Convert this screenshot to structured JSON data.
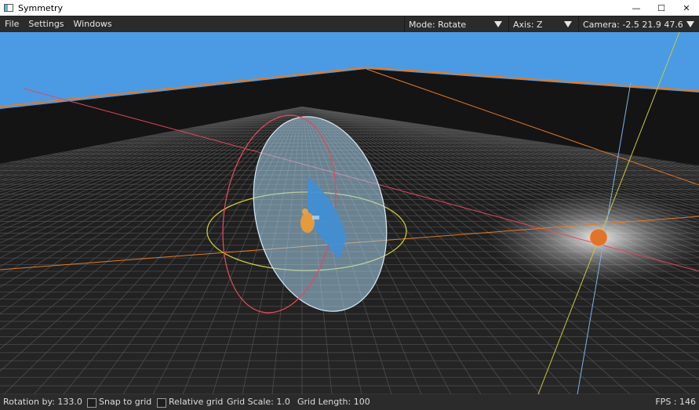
{
  "window": {
    "title": "Symmetry",
    "minimize": "—",
    "maximize": "☐",
    "close": "✕"
  },
  "menu": {
    "file": "File",
    "settings": "Settings",
    "windows": "Windows"
  },
  "toolbar": {
    "mode": "Mode: Rotate",
    "axis": "Axis: Z",
    "camera": "Camera: -2.5  21.9  47.6"
  },
  "status": {
    "rotation": "Rotation by: 133.0",
    "snap_label": "Snap to grid",
    "snap_checked": false,
    "relative_label": "Relative grid",
    "relative_checked": false,
    "grid_scale": "Grid Scale: 1.0",
    "grid_length": "Grid Length: 100",
    "fps": "FPS : 146"
  },
  "colors": {
    "sky": "#4a9be3",
    "floor": "#202020",
    "grid": "#5a5a5a",
    "gizmo_disc": "#a9d3ef",
    "ring_red": "#e04a5a",
    "ring_yellow": "#c9c93a",
    "axis_orange": "#e07a2a",
    "axis_blue": "#7fb3e6",
    "light_glow": "#e8e8e8"
  }
}
